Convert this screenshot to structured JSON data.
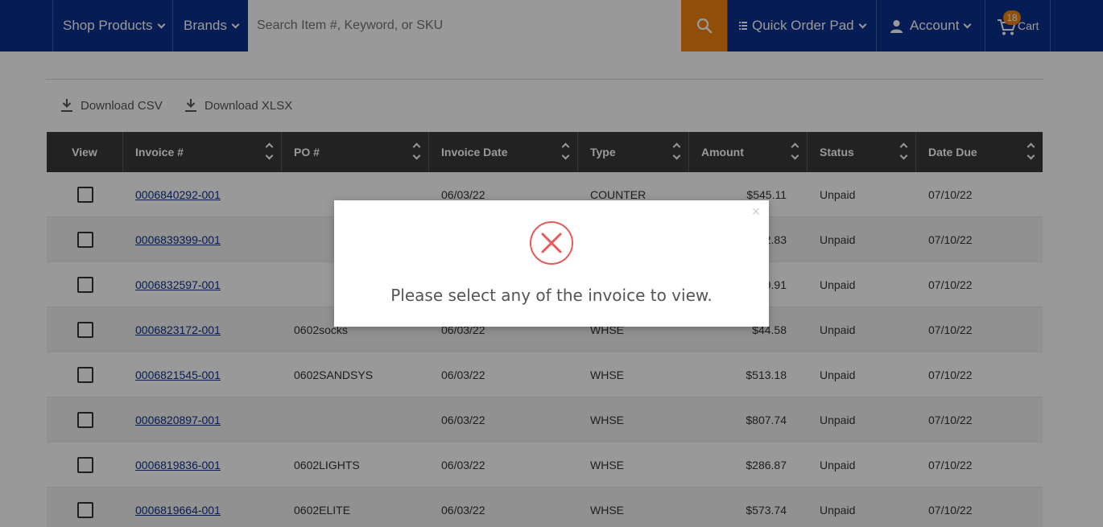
{
  "header": {
    "shop_products": "Shop Products",
    "brands": "Brands",
    "search_placeholder": "Search Item #, Keyword, or SKU",
    "quick_order_pad": "Quick Order Pad",
    "account": "Account",
    "cart_label": "Cart",
    "cart_count": "18",
    "colors": {
      "nav_bg": "#0a2f8c",
      "accent": "#f0830f"
    }
  },
  "downloads": {
    "csv": "Download CSV",
    "xlsx": "Download XLSX"
  },
  "table": {
    "columns": [
      "View",
      "Invoice #",
      "PO #",
      "Invoice Date",
      "Type",
      "Amount",
      "Status",
      "Date Due"
    ],
    "rows": [
      {
        "invoice": "0006840292-001",
        "po": "",
        "date": "06/03/22",
        "type": "COUNTER",
        "amount": "$545.11",
        "status": "Unpaid",
        "due": "07/10/22"
      },
      {
        "invoice": "0006839399-001",
        "po": "",
        "date": "",
        "type": "",
        "amount": "2.83",
        "status": "Unpaid",
        "due": "07/10/22"
      },
      {
        "invoice": "0006832597-001",
        "po": "",
        "date": "",
        "type": "",
        "amount": "9.91",
        "status": "Unpaid",
        "due": "07/10/22"
      },
      {
        "invoice": "0006823172-001",
        "po": "0602socks",
        "date": "06/03/22",
        "type": "WHSE",
        "amount": "$44.58",
        "status": "Unpaid",
        "due": "07/10/22"
      },
      {
        "invoice": "0006821545-001",
        "po": "0602SANDSYS",
        "date": "06/03/22",
        "type": "WHSE",
        "amount": "$513.18",
        "status": "Unpaid",
        "due": "07/10/22"
      },
      {
        "invoice": "0006820897-001",
        "po": "",
        "date": "06/03/22",
        "type": "WHSE",
        "amount": "$807.74",
        "status": "Unpaid",
        "due": "07/10/22"
      },
      {
        "invoice": "0006819836-001",
        "po": "0602LIGHTS",
        "date": "06/03/22",
        "type": "WHSE",
        "amount": "$286.87",
        "status": "Unpaid",
        "due": "07/10/22"
      },
      {
        "invoice": "0006819664-001",
        "po": "0602ELITE",
        "date": "06/03/22",
        "type": "WHSE",
        "amount": "$573.74",
        "status": "Unpaid",
        "due": "07/10/22"
      }
    ]
  },
  "modal": {
    "message": "Please select any of the invoice to view.",
    "close_glyph": "×",
    "icon": "error-x-circle-icon",
    "icon_color": "#e85a5a"
  }
}
